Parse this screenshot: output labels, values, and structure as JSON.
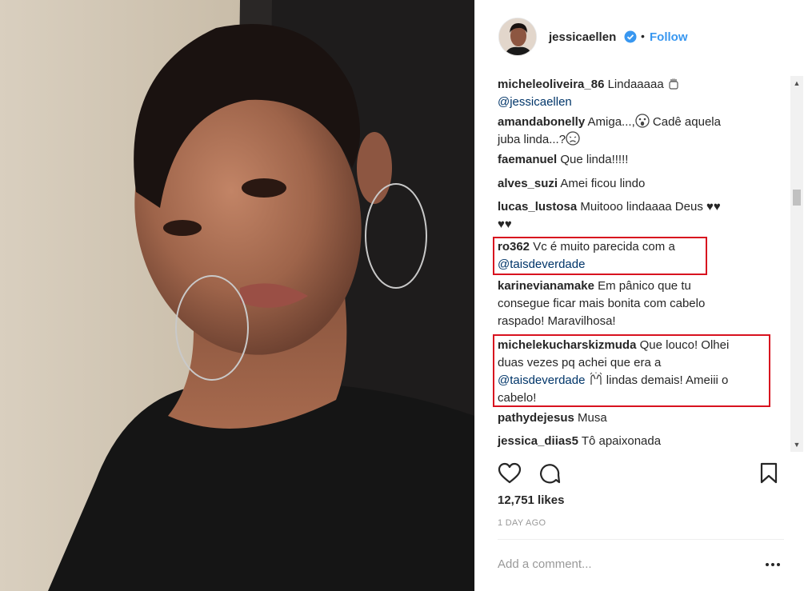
{
  "post": {
    "username": "jessicaellen",
    "separator": "•",
    "follow_label": "Follow",
    "verified_icon": "verified-badge-icon",
    "comments": [
      {
        "user": "micheleoliveira_86",
        "parts": [
          {
            "text": " Lindaaaaa "
          }
        ],
        "emoji_after": "raised-fist-emoji",
        "line2_mention": "@jessicaellen"
      },
      {
        "user": "amandabonelly",
        "text1": " Amiga...,",
        "emoji1": "shocked-face-emoji",
        "text2": " Cadê aquela",
        "line2": "juba linda...?",
        "emoji2": "crying-face-emoji"
      },
      {
        "user": "faemanuel",
        "text": " Que linda!!!!!"
      },
      {
        "user": "alves_suzi",
        "text": " Amei ficou lindo"
      },
      {
        "user": "lucas_lustosa",
        "text": " Muitooo lindaaaa Deus ♥♥",
        "line2": "♥♥"
      },
      {
        "user": "ro362",
        "text": " Vc é muito parecida com a",
        "line2_mention": "@taisdeverdade"
      },
      {
        "user": "karinevianamake",
        "text": " Em pânico que tu",
        "line2": "consegue ficar mais bonita com cabelo",
        "line3": "raspado! Maravilhosa!"
      },
      {
        "user": "michelekucharskizmuda",
        "text": " Que louco! Olhei",
        "line2": "duas vezes pq achei que era a",
        "line3_mention": "@taisdeverdade",
        "line3_emoji": "raised-hands-emoji",
        "line3_text": " lindas demais! Ameiii o",
        "line4": "cabelo!"
      },
      {
        "user": "pathydejesus",
        "text": " Musa"
      },
      {
        "user": "jessica_diias5",
        "text": " Tô apaixonada"
      }
    ],
    "likes": "12,751 likes",
    "time": "1 DAY AGO",
    "add_comment_placeholder": "Add a comment...",
    "more_label": "•••"
  },
  "colors": {
    "follow": "#3897f0",
    "mention": "#003569",
    "highlight": "#d8121f"
  }
}
